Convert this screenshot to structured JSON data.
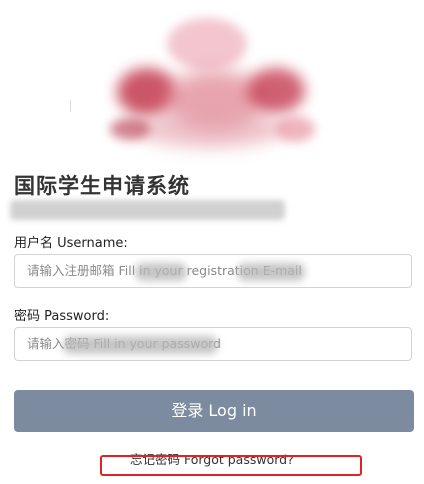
{
  "page": {
    "title": "国际学生申请系统"
  },
  "form": {
    "username_label": "用户名 Username:",
    "username_placeholder": "请输入注册邮箱 Fill in your registration E-mail",
    "password_label": "密码 Password:",
    "password_placeholder": "请输入密码 Fill in your password"
  },
  "actions": {
    "login_label": "登录 Log in",
    "forgot_label": "忘记密码 Forgot password?"
  },
  "colors": {
    "button_bg": "#7d8ba1",
    "annotation": "#e02222"
  }
}
